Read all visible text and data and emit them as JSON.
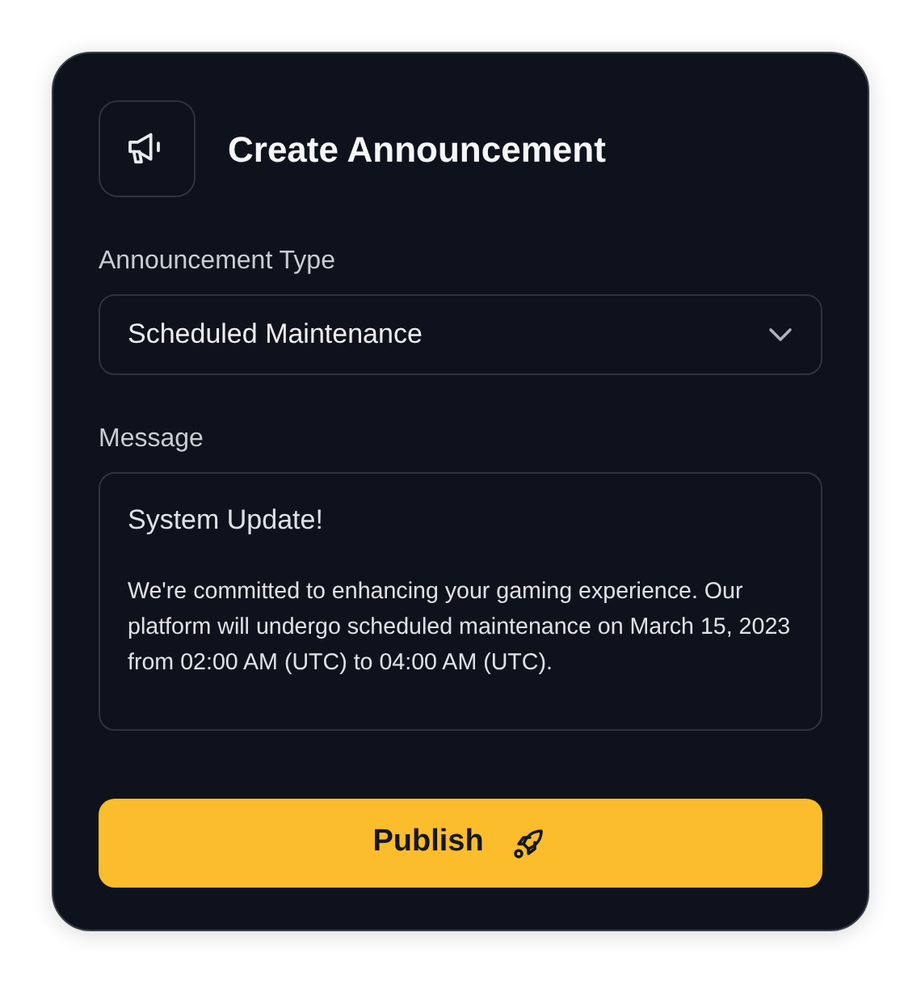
{
  "title": "Create Announcement",
  "type_field": {
    "label": "Announcement Type",
    "value": "Scheduled Maintenance"
  },
  "message_field": {
    "label": "Message",
    "heading": "System Update!",
    "body": "We're committed to enhancing your gaming experience. Our platform will undergo scheduled maintenance on March 15, 2023 from 02:00 AM (UTC) to 04:00 AM (UTC)."
  },
  "publish_button": {
    "label": "Publish"
  }
}
